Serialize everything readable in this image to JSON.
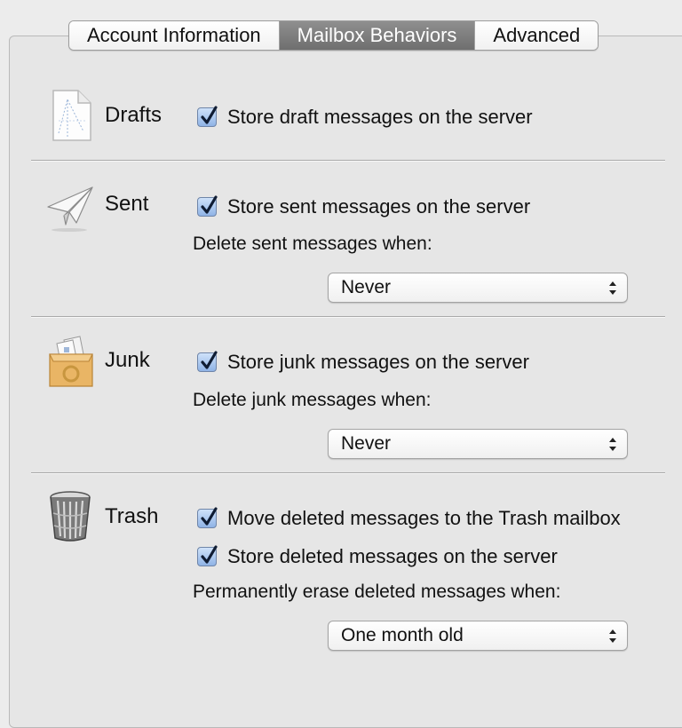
{
  "tabs": [
    {
      "label": "Account Information",
      "active": false
    },
    {
      "label": "Mailbox Behaviors",
      "active": true
    },
    {
      "label": "Advanced",
      "active": false
    }
  ],
  "drafts": {
    "title": "Drafts",
    "icon": "drafts-document-icon",
    "store_label": "Store draft messages on the server",
    "store_checked": true
  },
  "sent": {
    "title": "Sent",
    "icon": "paper-plane-icon",
    "store_label": "Store sent messages on the server",
    "store_checked": true,
    "delete_label": "Delete sent messages when:",
    "delete_value": "Never"
  },
  "junk": {
    "title": "Junk",
    "icon": "junk-box-icon",
    "store_label": "Store junk messages on the server",
    "store_checked": true,
    "delete_label": "Delete junk messages when:",
    "delete_value": "Never"
  },
  "trash": {
    "title": "Trash",
    "icon": "trash-can-icon",
    "move_label": "Move deleted messages to the Trash mailbox",
    "move_checked": true,
    "store_label": "Store deleted messages on the server",
    "store_checked": true,
    "erase_label": "Permanently erase deleted messages when:",
    "erase_value": "One month old"
  },
  "colors": {
    "background": "#e6e6e6",
    "active_tab": "#7f7f7f",
    "checkbox_blue": "#8fb3e6",
    "checkmark": "#0f1c33"
  }
}
